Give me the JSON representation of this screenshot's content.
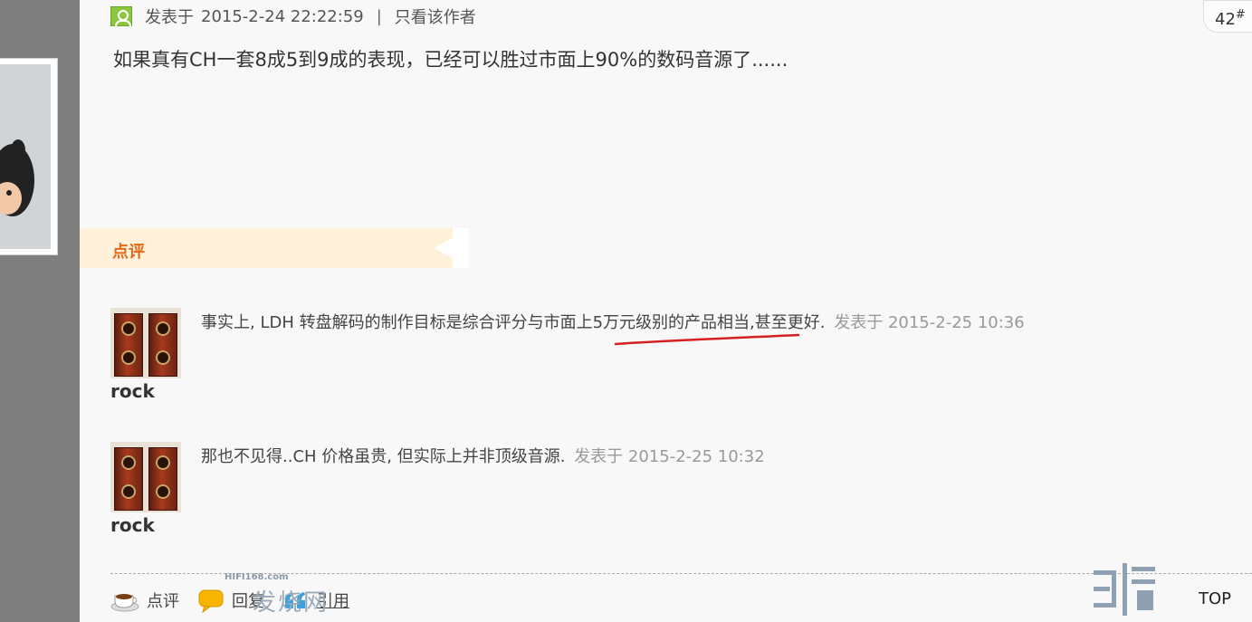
{
  "post": {
    "posted_prefix": "发表于",
    "posted_time": "2015-2-24 22:22:59",
    "separator": "|",
    "only_author": "只看该作者",
    "floor_number": "42",
    "floor_suffix": "#",
    "content": "如果真有CH一套8成5到9成的表现，已经可以胜过市面上90%的数码音源了......"
  },
  "comments_section": {
    "title": "点评",
    "comments": [
      {
        "user": "rock",
        "text_before": "事实上, LDH 转盘解码的制作目标是综合评分与市面上",
        "text_highlight": "5万元级别的产品相当",
        "text_after": ",甚至更好.",
        "date": "发表于 2015-2-25 10:36"
      },
      {
        "user": "rock",
        "text": "那也不见得..CH 价格虽贵, 但实际上并非顶级音源.",
        "date": "发表于 2015-2-25 10:32"
      }
    ]
  },
  "actions": {
    "comment": "点评",
    "reply": "回复",
    "quote": "引用"
  },
  "watermark": {
    "site": "HIFI168.com",
    "text": "发烧网"
  },
  "top_link": "TOP",
  "icons": {
    "online": "user-online-icon",
    "comment": "coffee-cup-icon",
    "reply": "speech-bubble-icon",
    "quote": "quote-mark-icon"
  },
  "colors": {
    "online_green": "#8cc63f",
    "comment_title": "#e06a1b",
    "comment_bar": "#fff1da",
    "underline_mark": "#d42020",
    "quote_blue": "#3aa0e0"
  }
}
